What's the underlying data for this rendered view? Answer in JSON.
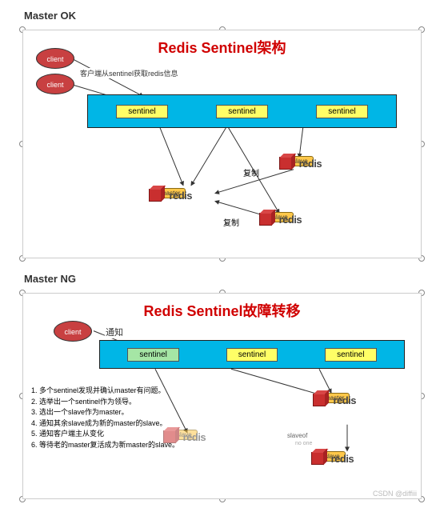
{
  "section1_title": "Master OK",
  "section2_title": "Master NG",
  "diagram1": {
    "title": "Redis Sentinel架构",
    "client_label": "client",
    "client_annotation": "客户端从sentinel获取redis信息",
    "sentinel_label": "sentinel",
    "redis_label": "redis",
    "master_tag": "master",
    "slave_tag": "slave",
    "replication_label": "复制"
  },
  "diagram2": {
    "title": "Redis Sentinel故障转移",
    "client_label": "client",
    "notify_label": "通知",
    "sentinel_label": "sentinel",
    "redis_label": "redis",
    "master_tag": "master",
    "slave_tag": "slave",
    "slaveof_label": "slaveof",
    "noone_label": "no one",
    "steps": [
      "1. 多个sentinel发现并确认master有问题。",
      "2. 选举出一个sentinel作为领导。",
      "3. 选出一个slave作为master。",
      "4. 通知其余slave成为新的master的slave。",
      "5. 通知客户端主从变化",
      "6. 等待老的master复活成为新master的slave。"
    ]
  },
  "watermark": "CSDN @diffiii"
}
